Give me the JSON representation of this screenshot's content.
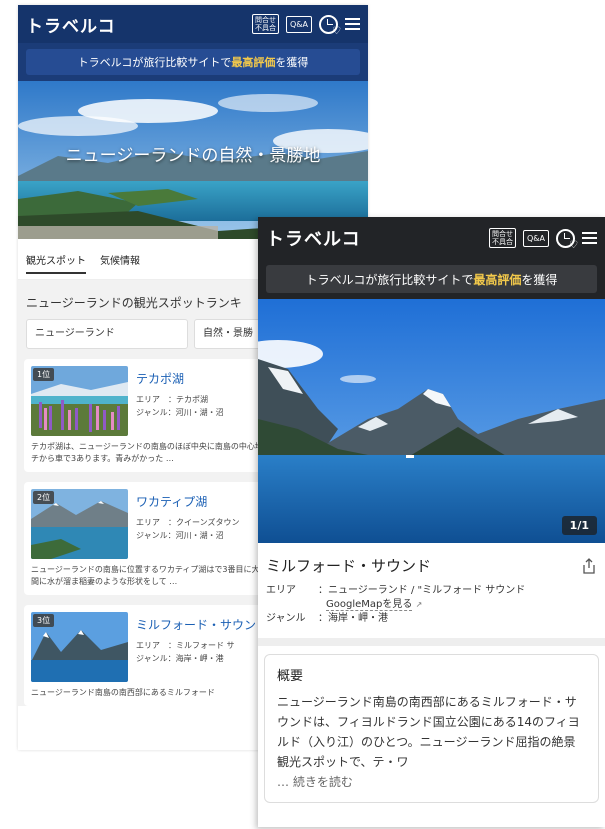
{
  "header": {
    "logo": "トラベルコ",
    "contact_line1": "問合せ",
    "contact_line2": "不具合",
    "qa": "Q&A"
  },
  "banner": {
    "pre": "トラベルコが旅行比較サイトで",
    "highlight": "最高評価",
    "post": "を獲得"
  },
  "list_page": {
    "hero_title": "ニュージーランドの自然・景勝地",
    "tabs": [
      "観光スポット",
      "気候情報"
    ],
    "ranking_title": "ニュージーランドの観光スポットランキ",
    "filter_region": "ニュージーランド",
    "filter_category": "自然・景勝",
    "items": [
      {
        "rank": "1位",
        "name": "テカポ湖",
        "area": "エリア　：テカポ湖",
        "genre": "ジャンル：河川・湖・沼",
        "desc": "テカポ湖は、ニュージーランドの南島のほぼ中央に南島の中心地であるクライストチャーチから車で3あります。青みがかった …"
      },
      {
        "rank": "2位",
        "name": "ワカティプ湖",
        "area": "エリア　：クイーンズタウン",
        "genre": "ジャンル：河川・湖・沼",
        "desc": "ニュージーランドの南島に位置するワカティプ湖はで3番目に大きな湖。氷河が削った谷間に水が溜ま稲妻のような形状をして …"
      },
      {
        "rank": "3位",
        "name": "ミルフォード・サウン",
        "area": "エリア　：ミルフォード サ",
        "genre": "ジャンル：海岸・岬・港",
        "desc": "ニュージーランド南島の南西部にあるミルフォード"
      }
    ]
  },
  "detail_page": {
    "counter": "1/1",
    "title": "ミルフォード・サウンド",
    "area_label": "エリア",
    "area_value": "：ニュージーランド / \"ミルフォード サウンド",
    "gmap_link": "GoogleMapを見る",
    "genre_label": "ジャンル",
    "genre_value": "：海岸・岬・港",
    "overview_heading": "概要",
    "overview_text": "ニュージーランド南島の南西部にあるミルフォード・サウンドは、フィヨルドランド国立公園にある14のフィヨルド（入り江）のひとつ。ニュージーランド屈指の絶景観光スポットで、テ・ワ",
    "read_more": "… 続きを読む"
  },
  "colors": {
    "header_blue": "#15346b",
    "header_dark": "#222427",
    "highlight": "#f3c94b",
    "link_blue": "#1a5fb4"
  }
}
